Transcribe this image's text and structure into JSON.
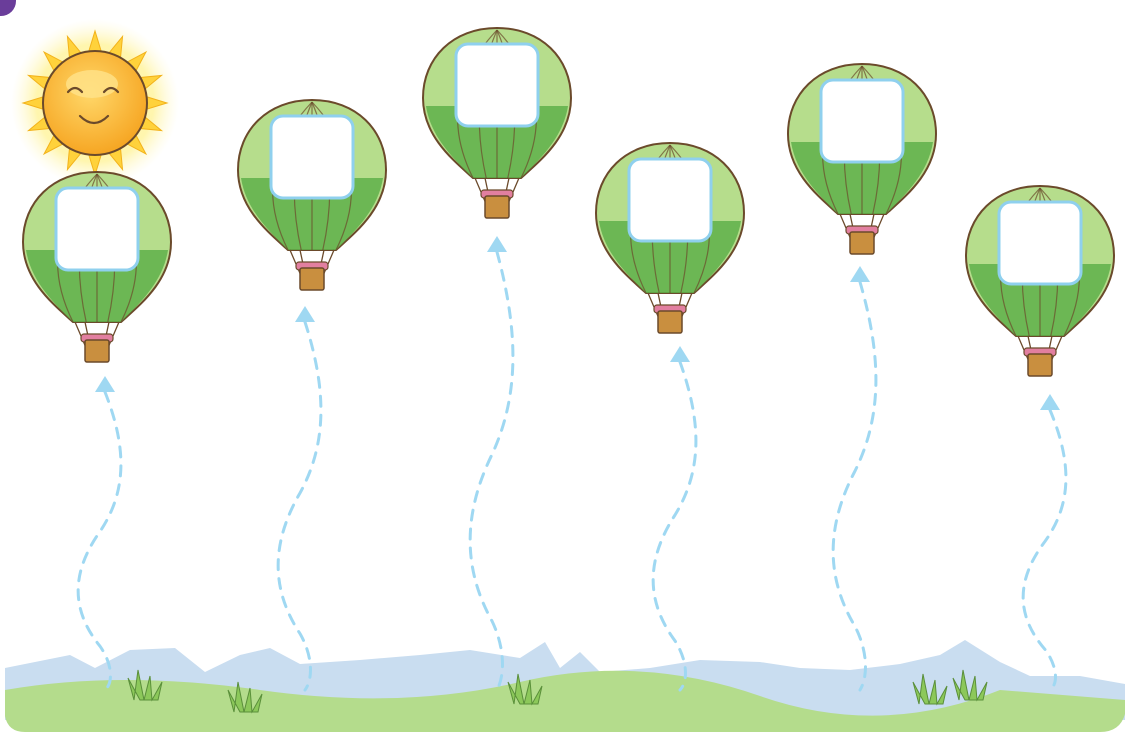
{
  "worksheet": {
    "side_credit": "",
    "balloon_count": 6,
    "colors": {
      "balloon_light": "#b6dd8c",
      "balloon_dark": "#5fb04a",
      "balloon_outline": "#6b4a2b",
      "answer_box_border": "#8fd0ee",
      "basket": "#c98f3f",
      "basket_trim": "#e27fa0",
      "dashed_path": "#9fd8f2",
      "mountains": "#c9ddf0",
      "grass": "#b4dc8c",
      "sun": "#ffd23b",
      "sun_glow": "#fff3a6",
      "badge": "#6a3d9a"
    },
    "icons": [
      "sun-icon",
      "hot-air-balloon-icon",
      "grass-tuft-icon",
      "arrow-up-icon"
    ]
  }
}
